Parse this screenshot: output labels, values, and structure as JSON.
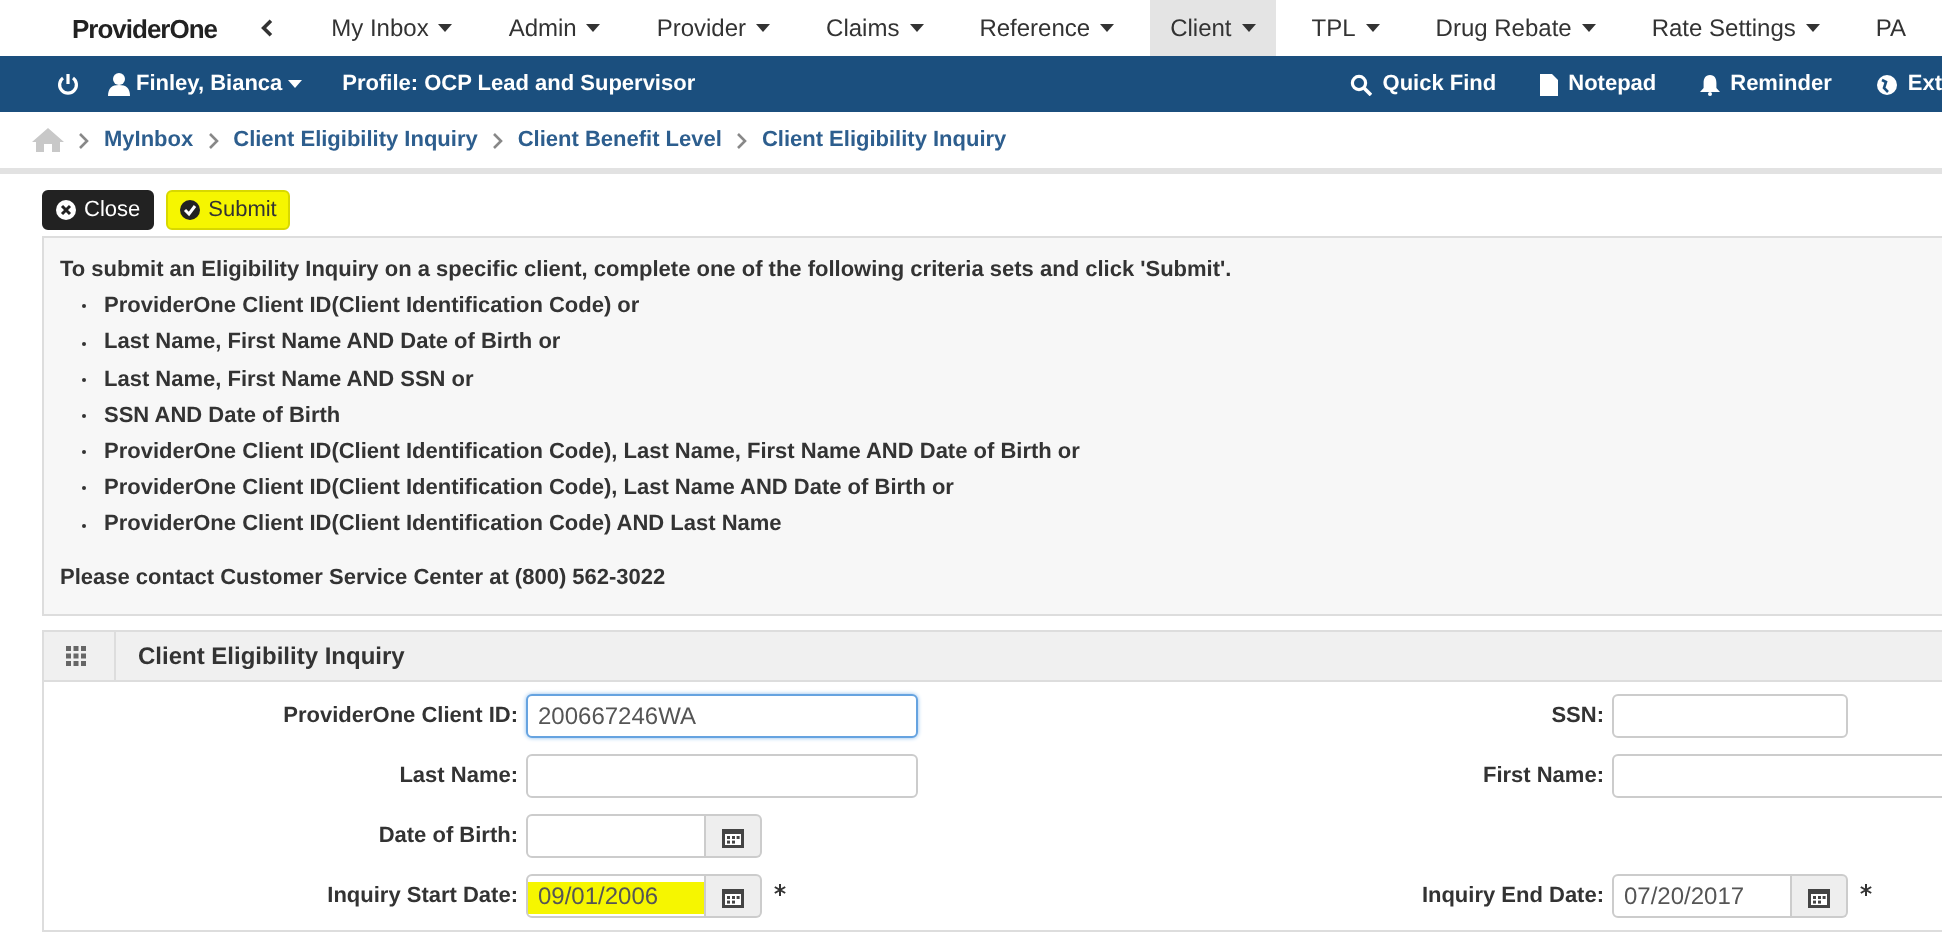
{
  "logo": {
    "text": "ProviderOne"
  },
  "menu": [
    {
      "label": "My Inbox",
      "selected": false
    },
    {
      "label": "Admin",
      "selected": false
    },
    {
      "label": "Provider",
      "selected": false
    },
    {
      "label": "Claims",
      "selected": false
    },
    {
      "label": "Reference",
      "selected": false
    },
    {
      "label": "Client",
      "selected": true
    },
    {
      "label": "TPL",
      "selected": false
    },
    {
      "label": "Drug Rebate",
      "selected": false
    },
    {
      "label": "Rate Settings",
      "selected": false
    },
    {
      "label": "PA",
      "selected": false
    }
  ],
  "userbar": {
    "user": "Finley, Bianca",
    "profile": "Profile: OCP Lead and Supervisor",
    "actions": [
      {
        "kind": "search",
        "label": "Quick Find"
      },
      {
        "kind": "note",
        "label": "Notepad"
      },
      {
        "kind": "bell",
        "label": "Reminder"
      },
      {
        "kind": "globe",
        "label": "Ext"
      }
    ]
  },
  "breadcrumb": [
    "MyInbox",
    "Client Eligibility Inquiry",
    "Client Benefit Level",
    "Client Eligibility Inquiry"
  ],
  "buttons": [
    {
      "kind": "close",
      "label": "Close",
      "highlighted": false
    },
    {
      "kind": "submit",
      "label": "Submit",
      "highlighted": true
    }
  ],
  "instructions": {
    "intro": "To submit an Eligibility Inquiry on a specific client, complete one of the following criteria sets and click 'Submit'.",
    "items": [
      "ProviderOne Client ID(Client Identification Code) or",
      "Last Name, First Name AND Date of Birth or",
      "Last Name, First Name AND SSN or",
      "SSN AND Date of Birth",
      "ProviderOne Client ID(Client Identification Code), Last Name, First Name AND Date of Birth or",
      "ProviderOne Client ID(Client Identification Code), Last Name AND Date of Birth or",
      "ProviderOne Client ID(Client Identification Code) AND Last Name"
    ],
    "contact": "Please contact Customer Service Center at (800) 562-3022"
  },
  "panel": {
    "title": "Client Eligibility Inquiry",
    "rows": [
      {
        "left": {
          "label": "ProviderOne Client ID:",
          "kind": "text",
          "value": "200667246WA",
          "focused": true,
          "required": false,
          "highlighted": false
        },
        "right": {
          "label": "SSN:",
          "kind": "short",
          "focused": false,
          "required": false,
          "highlighted": false
        }
      },
      {
        "left": {
          "label": "Last Name:",
          "kind": "text",
          "focused": false,
          "required": false,
          "highlighted": false
        },
        "right": {
          "label": "First Name:",
          "kind": "text",
          "focused": false,
          "required": false,
          "highlighted": false
        }
      },
      {
        "left": {
          "label": "Date of Birth:",
          "kind": "date",
          "focused": false,
          "required": false,
          "highlighted": false
        }
      },
      {
        "left": {
          "label": "Inquiry Start Date:",
          "kind": "date",
          "value": "09/01/2006",
          "focused": false,
          "required": true,
          "highlighted": true
        },
        "right": {
          "label": "Inquiry End Date:",
          "kind": "date",
          "value": "07/20/2017",
          "focused": false,
          "required": true,
          "highlighted": false
        }
      }
    ]
  }
}
